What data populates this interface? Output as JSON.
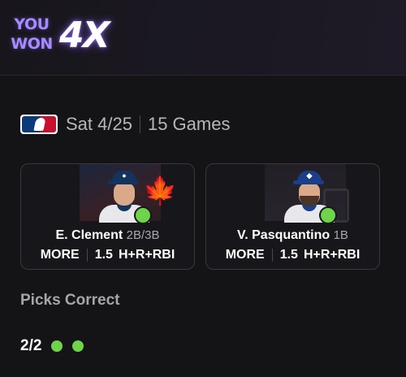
{
  "banner": {
    "you_label": "YOU",
    "won_label": "WON",
    "multiplier": "4X",
    "accent_color": "#a68bff"
  },
  "slate": {
    "league_icon": "mlb-logo-icon",
    "date": "Sat 4/25",
    "games": "15 Games"
  },
  "picks": [
    {
      "name": "E. Clement",
      "position": "2B/3B",
      "pick": "MORE",
      "line": "1.5",
      "stat": "H+R+RBI",
      "team_icon": "blue-jays-icon",
      "cap_color": "#13345c",
      "result": "correct"
    },
    {
      "name": "V. Pasquantino",
      "position": "1B",
      "pick": "MORE",
      "line": "1.5",
      "stat": "H+R+RBI",
      "team_icon": "royals-icon",
      "cap_color": "#1a3f8a",
      "result": "correct"
    }
  ],
  "summary": {
    "title": "Picks Correct",
    "score": "2/2",
    "correct_color": "#6ed44a"
  }
}
